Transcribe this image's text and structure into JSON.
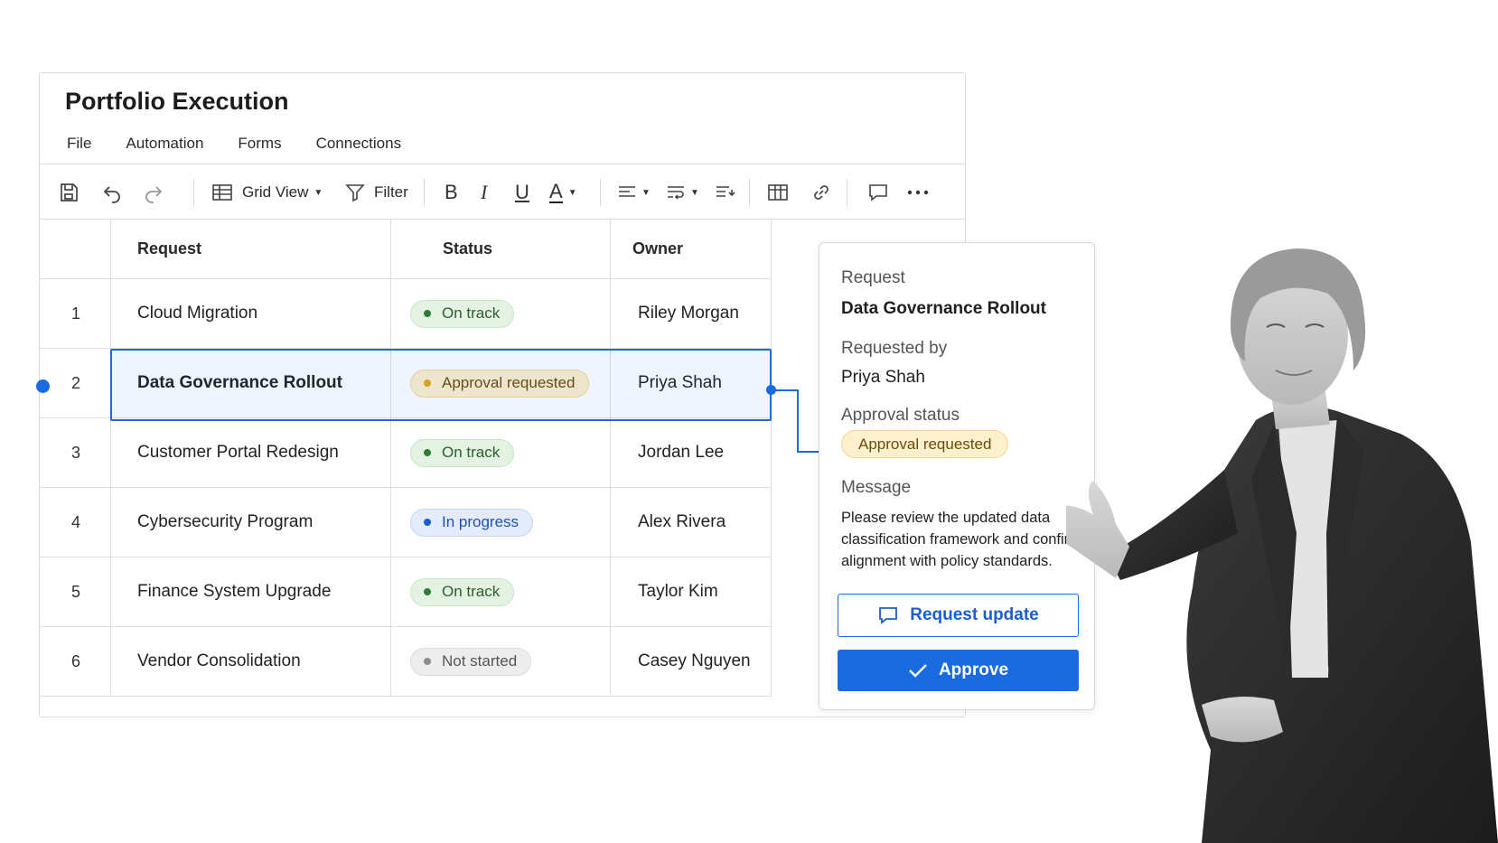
{
  "app": {
    "title": "Portfolio Execution",
    "menu": [
      "File",
      "Automation",
      "Forms",
      "Connections"
    ]
  },
  "toolbar": {
    "view_label": "Grid View",
    "filter_label": "Filter",
    "bold": "B",
    "italic": "I",
    "underline": "U",
    "text_color": "A"
  },
  "table": {
    "columns": [
      "Request",
      "Status",
      "Owner"
    ],
    "rows": [
      {
        "num": "1",
        "request": "Cloud Migration",
        "status": "On track",
        "owner": "Riley Morgan"
      },
      {
        "num": "2",
        "request": "Data Governance Rollout",
        "status": "Approval requested",
        "owner": "Priya Shah"
      },
      {
        "num": "3",
        "request": "Customer Portal Redesign",
        "status": "On track",
        "owner": "Jordan Lee"
      },
      {
        "num": "4",
        "request": "Cybersecurity Program",
        "status": "In progress",
        "owner": "Alex Rivera"
      },
      {
        "num": "5",
        "request": "Finance System Upgrade",
        "status": "On track",
        "owner": "Taylor Kim"
      },
      {
        "num": "6",
        "request": "Vendor Consolidation",
        "status": "Not started",
        "owner": "Casey Nguyen"
      }
    ]
  },
  "panel": {
    "request_label": "Request",
    "request_value": "Data Governance Rollout",
    "requested_by_label": "Requested by",
    "requested_by_value": "Priya Shah",
    "approval_label": "Approval status",
    "approval_value": "Approval requested",
    "message_label": "Message",
    "message_value": "Please review the updated data classification framework and confirm alignment with policy standards.",
    "request_update_label": "Request update",
    "approve_label": "Approve"
  },
  "colors": {
    "accent": "#1a6ae0",
    "status_green": "#2e7d32",
    "status_yellow": "#e6a517",
    "status_blue": "#1a5fd8",
    "status_gray": "#8c8c8c"
  }
}
